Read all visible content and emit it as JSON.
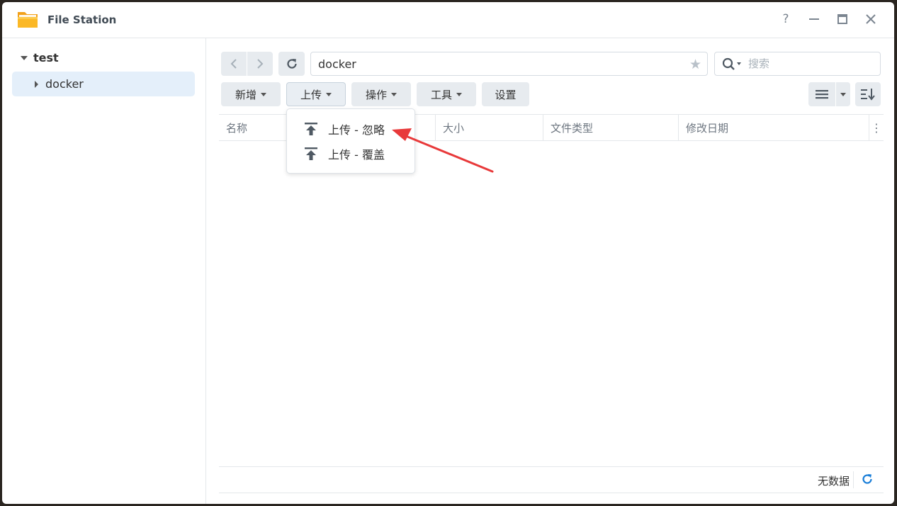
{
  "window": {
    "title": "File Station",
    "controls": {
      "help": "?",
      "minimize": "—",
      "maximize": "▭",
      "close": "✕"
    }
  },
  "sidebar": {
    "root": "test",
    "items": [
      {
        "label": "docker",
        "selected": true
      }
    ]
  },
  "navigation": {
    "path": "docker",
    "search_placeholder": "搜索"
  },
  "toolbar": {
    "buttons": [
      {
        "label": "新增",
        "has_dropdown": true
      },
      {
        "label": "上传",
        "has_dropdown": true,
        "active": true
      },
      {
        "label": "操作",
        "has_dropdown": true
      },
      {
        "label": "工具",
        "has_dropdown": true
      },
      {
        "label": "设置",
        "has_dropdown": false
      }
    ]
  },
  "upload_menu": {
    "items": [
      {
        "label": "上传 - 忽略",
        "icon": "upload-icon"
      },
      {
        "label": "上传 - 覆盖",
        "icon": "upload-icon"
      }
    ]
  },
  "file_list": {
    "columns": [
      "名称",
      "大小",
      "文件类型",
      "修改日期"
    ],
    "rows": []
  },
  "footer": {
    "status": "无数据"
  },
  "colors": {
    "accent": "#1a7ed8",
    "annotation_arrow": "#e8393a",
    "selected_bg": "#e4effa"
  }
}
